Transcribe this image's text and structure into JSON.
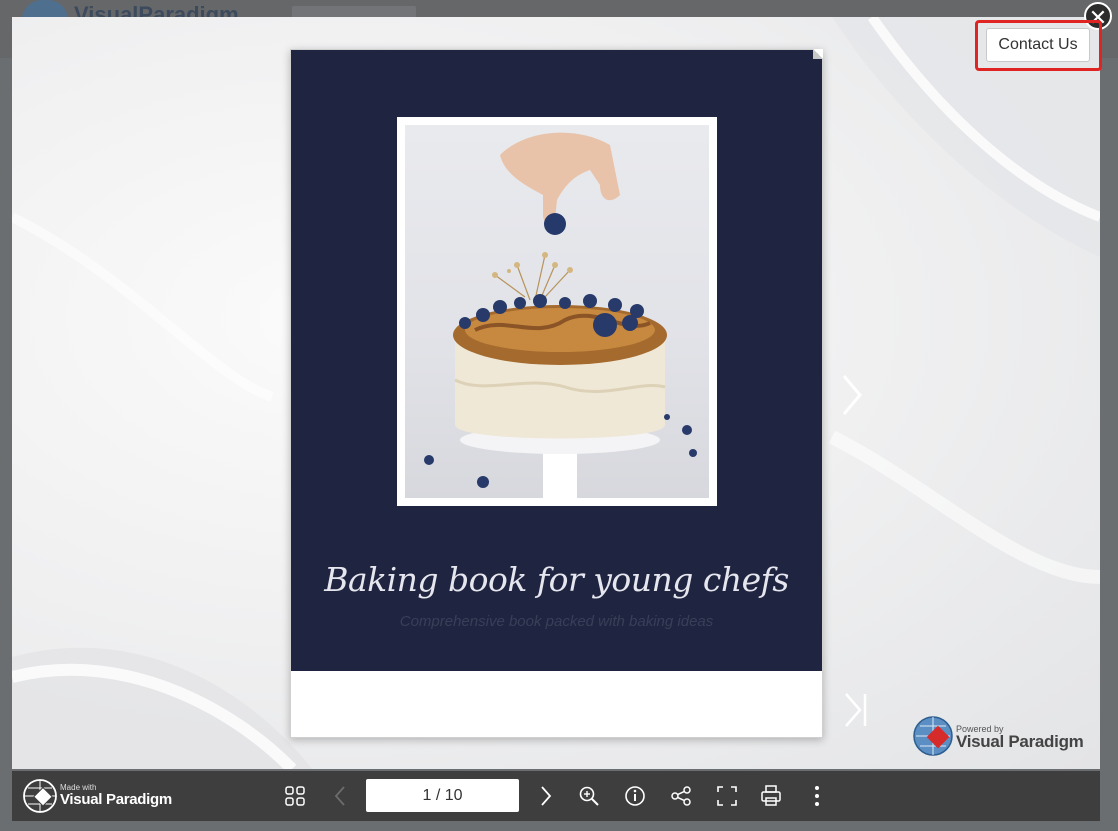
{
  "background_app": {
    "logo_text": "VisualParadigm"
  },
  "lightbox": {
    "contact_label": "Contact Us",
    "close_glyph": "✕"
  },
  "book": {
    "cover_color": "#1f2440",
    "title": "Baking book for young chefs",
    "subtitle": "Comprehensive book packed with baking ideas"
  },
  "powered_by": {
    "small": "Powered by",
    "brand": "Visual Paradigm"
  },
  "toolbar": {
    "made_with_small": "Made with",
    "made_with_brand": "Visual Paradigm",
    "page_indicator": "1 / 10",
    "icons": [
      "thumbnails-icon",
      "prev-page-icon",
      "next-page-icon",
      "zoom-in-icon",
      "info-icon",
      "share-icon",
      "fullscreen-icon",
      "print-icon",
      "more-icon"
    ]
  },
  "colors": {
    "accent": "#e02424",
    "toolbar": "#3e3e3e"
  }
}
